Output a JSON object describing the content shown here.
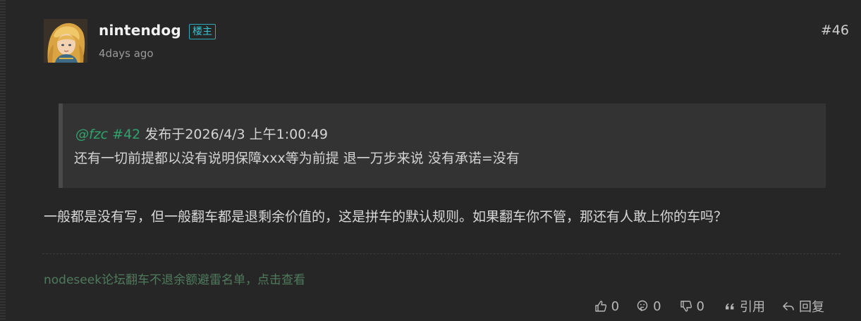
{
  "post": {
    "username": "nintendog",
    "op_badge": "楼主",
    "time": "4days ago",
    "floor": "#46",
    "quote": {
      "user": "@fzc",
      "floor_ref": "#42",
      "posted_at": "发布于2026/4/3 上午1:00:49",
      "text": "还有一切前提都以没有说明保障xxx等为前提 退一万步来说 没有承诺=没有"
    },
    "content": "一般都是没有写，但一般翻车都是退剩余价值的，这是拼车的默认规则。如果翻车你不管，那还有人敢上你的车吗？",
    "signature": "nodeseek论坛翻车不退余额避雷名单，点击查看",
    "actions": {
      "like_count": "0",
      "think_count": "0",
      "dislike_count": "0",
      "quote_label": "引用",
      "reply_label": "回复"
    }
  },
  "colors": {
    "background": "#262626",
    "accent_green": "#2fa36d",
    "badge_cyan": "#39c2d4",
    "signature_green": "#4f7a5c"
  },
  "icons": {
    "like": "thumbs-up-icon",
    "think": "thinking-face-icon",
    "dislike": "thumbs-down-icon",
    "quote": "quote-mark-icon",
    "reply": "reply-arrow-icon"
  }
}
